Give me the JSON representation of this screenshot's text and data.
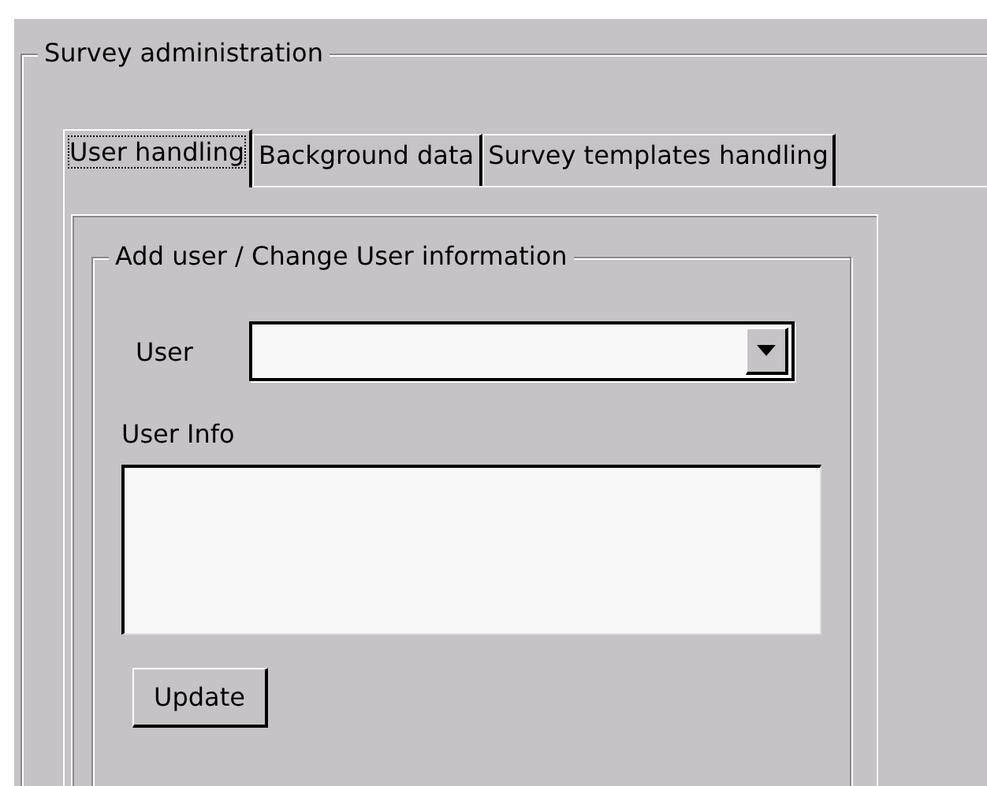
{
  "group": {
    "title": "Survey administration"
  },
  "tabs": [
    {
      "label": "User handling",
      "selected": true
    },
    {
      "label": "Background data",
      "selected": false
    },
    {
      "label": "Survey templates handling",
      "selected": false
    }
  ],
  "user_group": {
    "title": "Add user / Change User information",
    "user_label": "User",
    "user_info_label": "User Info",
    "update_button": "Update"
  }
}
